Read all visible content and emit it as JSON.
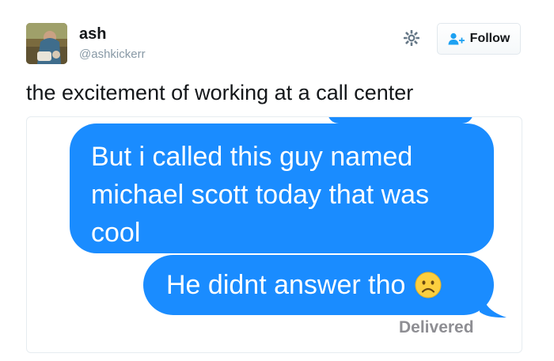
{
  "tweet": {
    "author": {
      "name": "ash",
      "handle": "@ashkickerr",
      "avatar": "profile-photo"
    },
    "settings_icon": "gear-icon",
    "follow_button": {
      "label": "Follow",
      "icon": "person-add-icon"
    },
    "text": "the excitement of working at a call center"
  },
  "media": {
    "messages": [
      {
        "text": "But i called this guy named\nmichael scott today that was\ncool",
        "color": "#1a8cff"
      },
      {
        "text": "He didnt answer tho",
        "emoji": "frowning-face",
        "color": "#1a8cff"
      }
    ],
    "status": "Delivered"
  },
  "colors": {
    "imessage_blue": "#1a8cff",
    "follow_icon_blue": "#1da1f2",
    "text_primary": "#14171a",
    "text_secondary": "#8899a6",
    "emoji_yellow": "#fccf3f"
  }
}
